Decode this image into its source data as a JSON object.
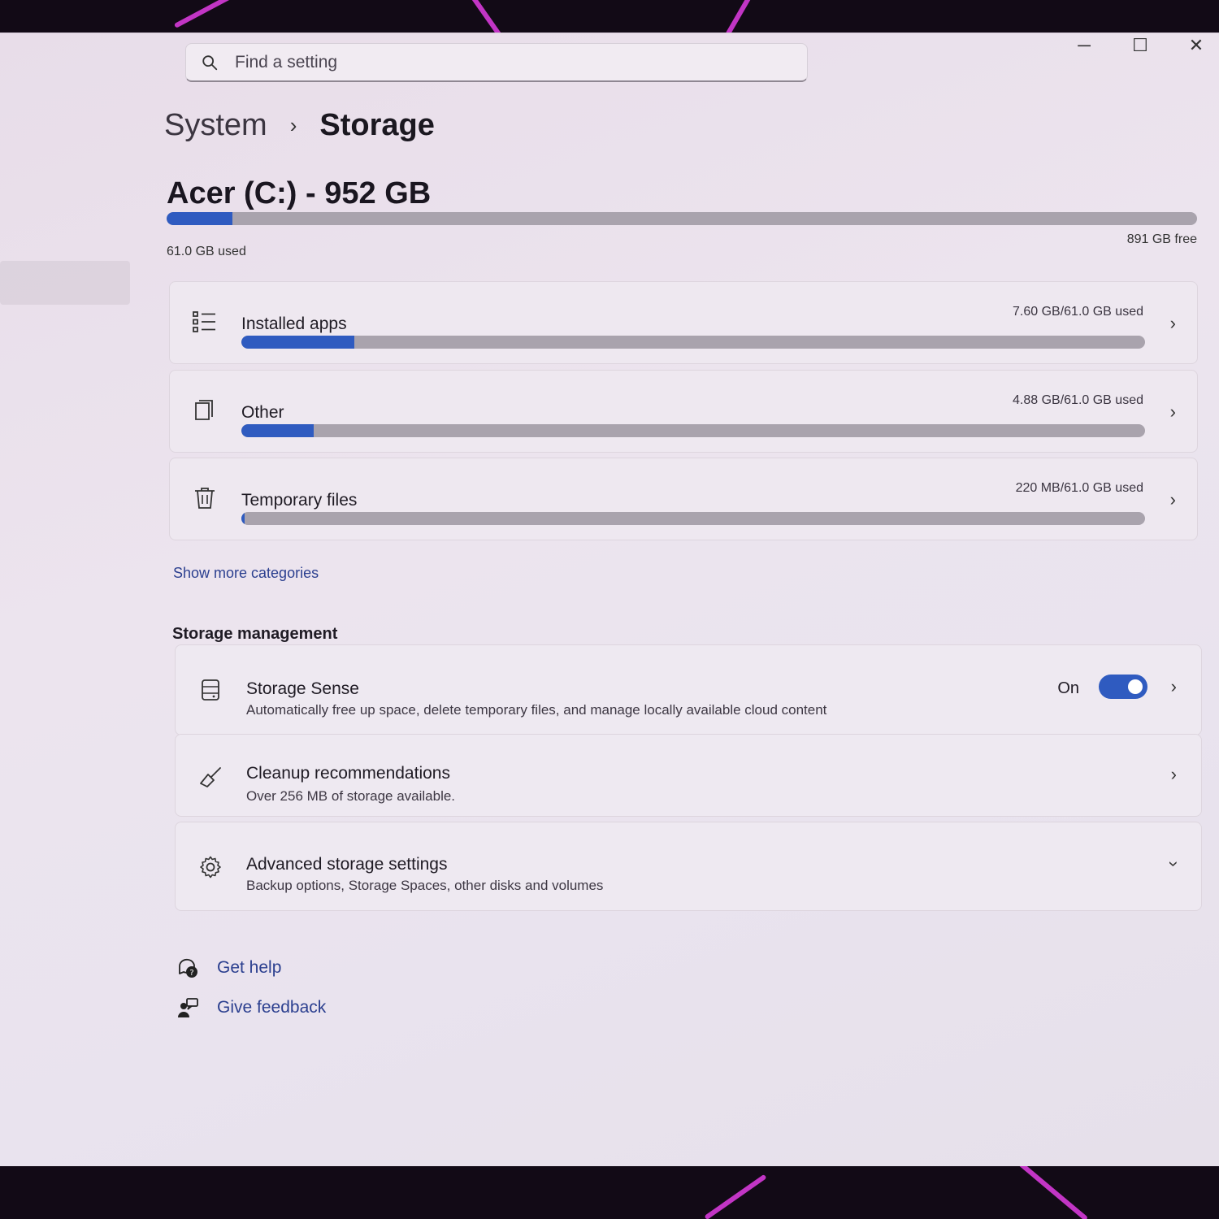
{
  "window_controls": {
    "minimize": "─",
    "maximize": "☐",
    "close": "✕"
  },
  "search": {
    "placeholder": "Find a setting"
  },
  "breadcrumb": {
    "parent": "System",
    "separator": "›",
    "current": "Storage"
  },
  "drive": {
    "title": "Acer (C:) - 952 GB",
    "used_label": "61.0 GB used",
    "free_label": "891 GB free",
    "used_fraction": 0.064
  },
  "categories": [
    {
      "label": "Installed apps",
      "amount": "7.60 GB/61.0 GB used",
      "fraction": 0.125,
      "icon": "list-icon"
    },
    {
      "label": "Other",
      "amount": "4.88 GB/61.0 GB used",
      "fraction": 0.08,
      "icon": "document-icon"
    },
    {
      "label": "Temporary files",
      "amount": "220 MB/61.0 GB used",
      "fraction": 0.0036,
      "icon": "trash-icon"
    }
  ],
  "show_more": "Show more categories",
  "storage_management": {
    "title": "Storage management",
    "storage_sense": {
      "title": "Storage Sense",
      "subtitle": "Automatically free up space, delete temporary files, and manage locally available cloud content",
      "toggle_label": "On",
      "enabled": true
    },
    "cleanup": {
      "title": "Cleanup recommendations",
      "subtitle": "Over 256 MB of storage available."
    },
    "advanced": {
      "title": "Advanced storage settings",
      "subtitle": "Backup options, Storage Spaces, other disks and volumes"
    }
  },
  "help": {
    "get_help": "Get help",
    "give_feedback": "Give feedback"
  },
  "colors": {
    "accent": "#2f5bc0",
    "bar_track": "#a9a3ad",
    "link": "#2b3f8f"
  }
}
